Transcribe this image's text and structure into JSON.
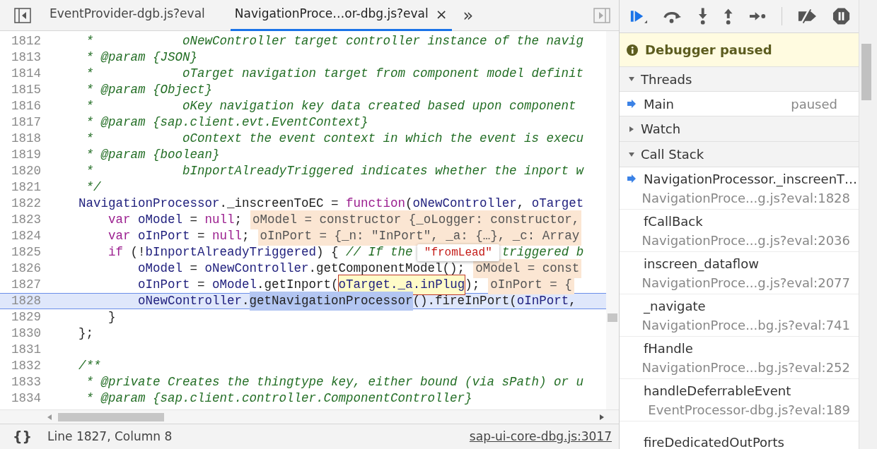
{
  "editor": {
    "tabs": [
      {
        "label": "EventProvider-dgb.js?eval",
        "selected": false,
        "closable": false
      },
      {
        "label": "NavigationProce…or-dbg.js?eval",
        "selected": true,
        "closable": true
      }
    ],
    "close_glyph": "×",
    "more_glyph": "»",
    "lines": [
      {
        "number": "1812",
        "current": false,
        "tokens": [
          {
            "kind": "comment",
            "text": "     *            oNewController target controller instance of the navig"
          }
        ]
      },
      {
        "number": "1813",
        "current": false,
        "tokens": [
          {
            "kind": "comment",
            "text": "     * @param {JSON}"
          }
        ]
      },
      {
        "number": "1814",
        "current": false,
        "tokens": [
          {
            "kind": "comment",
            "text": "     *            oTarget navigation target from component model definit"
          }
        ]
      },
      {
        "number": "1815",
        "current": false,
        "tokens": [
          {
            "kind": "comment",
            "text": "     * @param {Object}"
          }
        ]
      },
      {
        "number": "1816",
        "current": false,
        "tokens": [
          {
            "kind": "comment",
            "text": "     *            oKey navigation key data created based upon component"
          }
        ]
      },
      {
        "number": "1817",
        "current": false,
        "tokens": [
          {
            "kind": "comment",
            "text": "     * @param {sap.client.evt.EventContext}"
          }
        ]
      },
      {
        "number": "1818",
        "current": false,
        "tokens": [
          {
            "kind": "comment",
            "text": "     *            oContext the event context in which the event is execu"
          }
        ]
      },
      {
        "number": "1819",
        "current": false,
        "tokens": [
          {
            "kind": "comment",
            "text": "     * @param {boolean}"
          }
        ]
      },
      {
        "number": "1820",
        "current": false,
        "tokens": [
          {
            "kind": "comment",
            "text": "     *            bInportAlreadyTriggered indicates whether the inport w"
          }
        ]
      },
      {
        "number": "1821",
        "current": false,
        "tokens": [
          {
            "kind": "comment",
            "text": "     */"
          }
        ]
      },
      {
        "number": "1822",
        "current": false,
        "tokens": [
          {
            "kind": "variable",
            "text": "    NavigationProcessor"
          },
          {
            "kind": "plain",
            "text": "._inscreenToEC = "
          },
          {
            "kind": "keyword",
            "text": "function"
          },
          {
            "kind": "plain",
            "text": "("
          },
          {
            "kind": "variable",
            "text": "oNewController"
          },
          {
            "kind": "plain",
            "text": ", "
          },
          {
            "kind": "variable",
            "text": "oTarget"
          }
        ]
      },
      {
        "number": "1823",
        "current": false,
        "tokens": [
          {
            "kind": "keyword",
            "text": "        var "
          },
          {
            "kind": "variable",
            "text": "oModel"
          },
          {
            "kind": "plain",
            "text": " = "
          },
          {
            "kind": "keyword",
            "text": "null"
          },
          {
            "kind": "plain",
            "text": ";"
          },
          {
            "kind": "hint",
            "text": "oModel = constructor {_oLogger: constructor,"
          }
        ]
      },
      {
        "number": "1824",
        "current": false,
        "tokens": [
          {
            "kind": "keyword",
            "text": "        var "
          },
          {
            "kind": "variable",
            "text": "oInPort"
          },
          {
            "kind": "plain",
            "text": " = "
          },
          {
            "kind": "keyword",
            "text": "null"
          },
          {
            "kind": "plain",
            "text": ";"
          },
          {
            "kind": "hint",
            "text": "oInPort = {_n: \"InPort\", _a: {…}, _c: Array"
          }
        ]
      },
      {
        "number": "1825",
        "current": false,
        "tokens": [
          {
            "kind": "keyword",
            "text": "        if"
          },
          {
            "kind": "plain",
            "text": " (!"
          },
          {
            "kind": "variable",
            "text": "bInportAlreadyTriggered"
          },
          {
            "kind": "plain",
            "text": ") { "
          },
          {
            "kind": "comment",
            "text": "// If the"
          },
          {
            "kind": "comment",
            "text": "triggered b",
            "after_tooltip": true
          }
        ]
      },
      {
        "number": "1826",
        "current": false,
        "tokens": [
          {
            "kind": "variable",
            "text": "            oModel"
          },
          {
            "kind": "plain",
            "text": " = "
          },
          {
            "kind": "variable",
            "text": "oNewController"
          },
          {
            "kind": "plain",
            "text": ".getComponentModel();"
          },
          {
            "kind": "hint",
            "text": "oModel = const"
          }
        ]
      },
      {
        "number": "1827",
        "current": false,
        "tokens": [
          {
            "kind": "variable",
            "text": "            oInPort"
          },
          {
            "kind": "plain",
            "text": " = "
          },
          {
            "kind": "variable",
            "text": "oModel"
          },
          {
            "kind": "plain",
            "text": ".getInport("
          },
          {
            "kind": "boxed",
            "text": "oTarget._a.inPlug"
          },
          {
            "kind": "plain",
            "text": ");"
          },
          {
            "kind": "hint",
            "text": "oInPort = {"
          }
        ]
      },
      {
        "number": "1828",
        "current": true,
        "tokens": [
          {
            "kind": "variable",
            "text": "            oNewController"
          },
          {
            "kind": "plain",
            "text": "."
          },
          {
            "kind": "selection",
            "text": "getNavigationProcessor"
          },
          {
            "kind": "plain",
            "text": "().fireInPort("
          },
          {
            "kind": "variable",
            "text": "oInPort"
          },
          {
            "kind": "plain",
            "text": ","
          }
        ]
      },
      {
        "number": "1829",
        "current": false,
        "tokens": [
          {
            "kind": "plain",
            "text": "        }"
          }
        ]
      },
      {
        "number": "1830",
        "current": false,
        "tokens": [
          {
            "kind": "plain",
            "text": "    };"
          }
        ]
      },
      {
        "number": "1831",
        "current": false
      },
      {
        "number": "1832",
        "current": false,
        "tokens": [
          {
            "kind": "comment",
            "text": "    /**"
          }
        ]
      },
      {
        "number": "1833",
        "current": false,
        "tokens": [
          {
            "kind": "comment",
            "text": "     * @private Creates the thingtype key, either bound (via sPath) or u"
          }
        ]
      },
      {
        "number": "1834",
        "current": false,
        "tokens": [
          {
            "kind": "comment",
            "text": "     * @param {sap.client.controller.ComponentController}"
          }
        ]
      }
    ],
    "value_tooltip": "\"fromLead\"",
    "status_bar": {
      "format_glyph": "{}",
      "position": "Line 1827, Column 8",
      "source_link": "sap-ui-core-dbg.js:3017"
    }
  },
  "sidebar": {
    "banner": "Debugger paused",
    "threads": {
      "title": "Threads",
      "expanded": true,
      "items": [
        {
          "name": "Main",
          "status": "paused",
          "selected": true
        }
      ]
    },
    "watch": {
      "title": "Watch",
      "expanded": false
    },
    "call_stack": {
      "title": "Call Stack",
      "expanded": true,
      "frames": [
        {
          "name": "NavigationProcessor._inscreenT…",
          "location": "NavigationProce...g.js?eval:1828",
          "selected": true
        },
        {
          "name": "fCallBack",
          "location": "NavigationProce...g.js?eval:2036",
          "selected": false
        },
        {
          "name": "inscreen_dataflow",
          "location": "NavigationProce...g.js?eval:2077",
          "selected": false
        },
        {
          "name": "_navigate",
          "location": "NavigationProce...bg.js?eval:741",
          "selected": false
        },
        {
          "name": "fHandle",
          "location": "NavigationProce...bg.js?eval:252",
          "selected": false
        },
        {
          "name": "handleDeferrableEvent",
          "location": "EventProcessor-dbg.js?eval:189",
          "selected": false
        },
        {
          "name": "fireDedicatedOutPorts",
          "selected": false
        }
      ]
    }
  }
}
